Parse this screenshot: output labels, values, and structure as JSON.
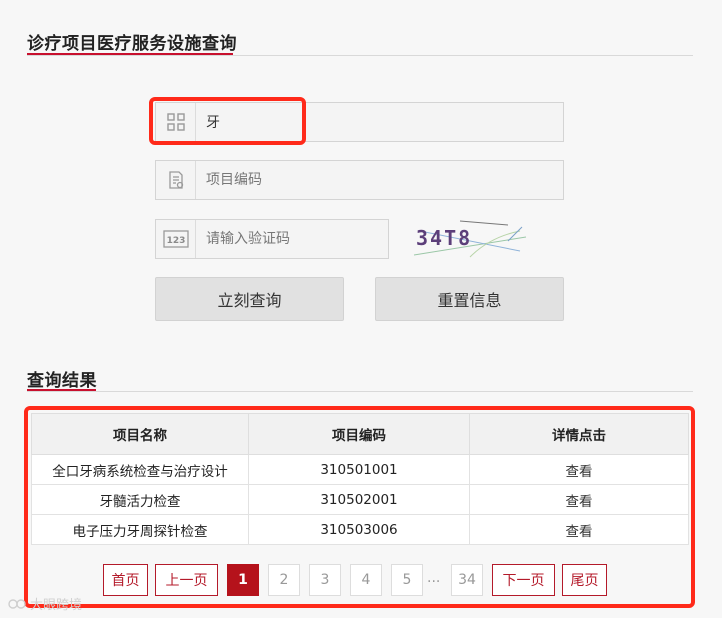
{
  "search_section": {
    "title": "诊疗项目医疗服务设施查询",
    "keyword_value": "牙",
    "code_placeholder": "项目编码",
    "captcha_placeholder": "请输入验证码",
    "captcha_text": "34T8",
    "query_button": "立刻查询",
    "reset_button": "重置信息"
  },
  "results_section": {
    "title": "查询结果",
    "columns": [
      "项目名称",
      "项目编码",
      "详情点击"
    ],
    "rows": [
      {
        "name": "全口牙病系统检查与治疗设计",
        "code": "310501001",
        "action": "查看"
      },
      {
        "name": "牙髓活力检查",
        "code": "310502001",
        "action": "查看"
      },
      {
        "name": "电子压力牙周探针检查",
        "code": "310503006",
        "action": "查看"
      }
    ]
  },
  "pagination": {
    "first": "首页",
    "prev": "上一页",
    "pages": [
      "1",
      "2",
      "3",
      "4",
      "5"
    ],
    "ellipsis": "...",
    "last_page": "34",
    "next": "下一页",
    "last": "尾页",
    "current": "1"
  },
  "watermark": "大眼跨境",
  "colors": {
    "accent_red": "#c8102e",
    "highlight_red": "#ff2a1a",
    "active_page": "#b5121b"
  }
}
